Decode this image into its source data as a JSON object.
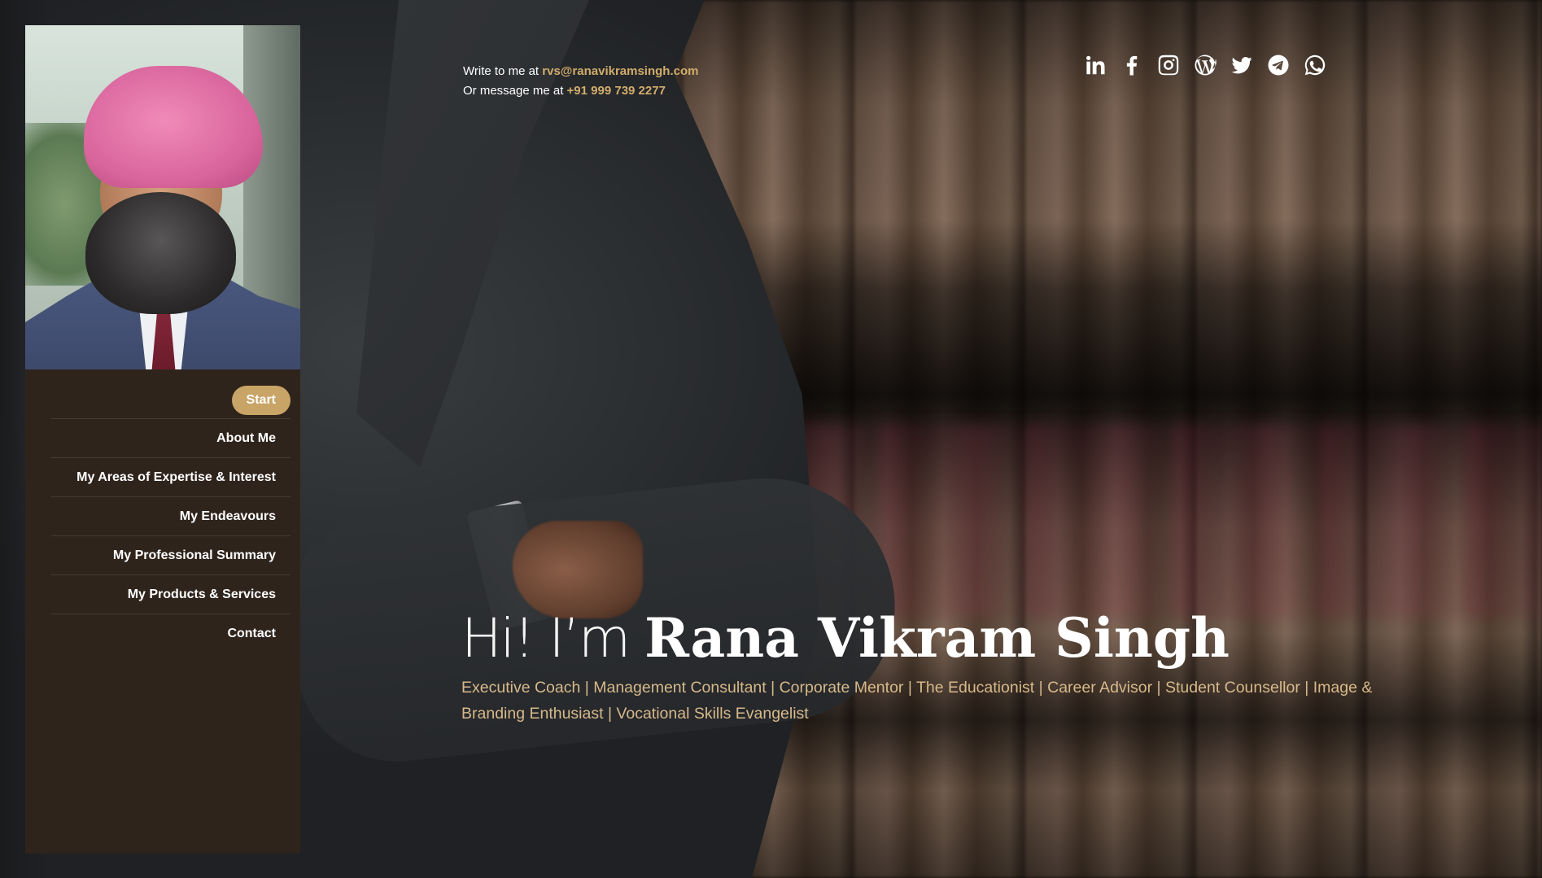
{
  "sidebar": {
    "nav": [
      {
        "label": "Start",
        "active": true
      },
      {
        "label": "About Me"
      },
      {
        "label": "My Areas of Expertise & Interest"
      },
      {
        "label": "My Endeavours"
      },
      {
        "label": "My Professional Summary"
      },
      {
        "label": "My Products & Services"
      },
      {
        "label": "Contact"
      }
    ]
  },
  "contact": {
    "email_prefix": "Write to me at ",
    "email": "rvs@ranavikramsingh.com",
    "phone_prefix": "Or message me at ",
    "phone": "+91 999 739 2277"
  },
  "socials": [
    {
      "icon": "linkedin-icon"
    },
    {
      "icon": "facebook-icon"
    },
    {
      "icon": "instagram-icon"
    },
    {
      "icon": "wordpress-icon"
    },
    {
      "icon": "twitter-icon"
    },
    {
      "icon": "telegram-icon"
    },
    {
      "icon": "whatsapp-icon"
    }
  ],
  "hero": {
    "greeting": "Hi! I’m ",
    "name": "Rana Vikram Singh",
    "subtitle": "Executive Coach | Management Consultant | Corporate Mentor | The Educationist | Career Advisor | Student Counsellor | Image & Branding Enthusiast | Vocational Skills Evangelist"
  },
  "colors": {
    "accent": "#c9a467",
    "sidebar_bg": "#2f241c",
    "subtitle": "#d7b98a"
  }
}
